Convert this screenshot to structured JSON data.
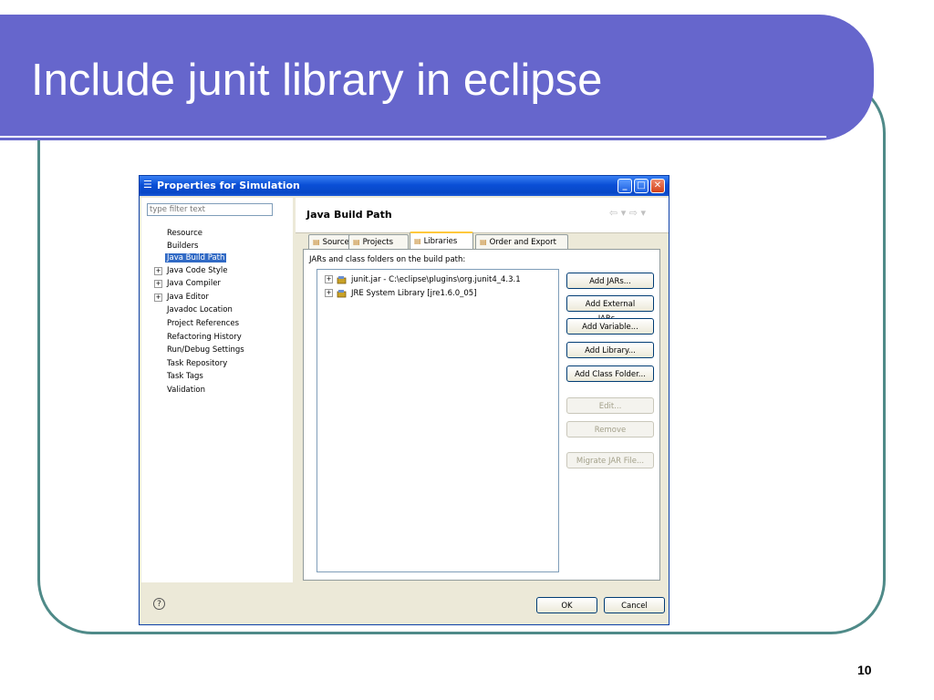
{
  "slide": {
    "title": "Include junit library in eclipse",
    "page_number": "10",
    "colors": {
      "banner": "#6666cc",
      "frame": "#4f8a88"
    }
  },
  "dialog": {
    "title": "Properties for Simulation",
    "filter_placeholder": "type filter text",
    "tree": [
      {
        "label": "Resource",
        "expandable": false,
        "selected": false
      },
      {
        "label": "Builders",
        "expandable": false,
        "selected": false
      },
      {
        "label": "Java Build Path",
        "expandable": false,
        "selected": true
      },
      {
        "label": "Java Code Style",
        "expandable": true,
        "selected": false
      },
      {
        "label": "Java Compiler",
        "expandable": true,
        "selected": false
      },
      {
        "label": "Java Editor",
        "expandable": true,
        "selected": false
      },
      {
        "label": "Javadoc Location",
        "expandable": false,
        "selected": false
      },
      {
        "label": "Project References",
        "expandable": false,
        "selected": false
      },
      {
        "label": "Refactoring History",
        "expandable": false,
        "selected": false
      },
      {
        "label": "Run/Debug Settings",
        "expandable": false,
        "selected": false
      },
      {
        "label": "Task Repository",
        "expandable": false,
        "selected": false
      },
      {
        "label": "Task Tags",
        "expandable": false,
        "selected": false
      },
      {
        "label": "Validation",
        "expandable": false,
        "selected": false
      }
    ],
    "page_title": "Java Build Path",
    "tabs": [
      {
        "label": "Source",
        "icon": "source-folder-icon",
        "active": false
      },
      {
        "label": "Projects",
        "icon": "projects-folder-icon",
        "active": false
      },
      {
        "label": "Libraries",
        "icon": "libraries-icon",
        "active": true
      },
      {
        "label": "Order and Export",
        "icon": "order-export-icon",
        "active": false
      }
    ],
    "panel_label": "JARs and class folders on the build path:",
    "libraries": [
      {
        "label": "junit.jar - C:\\eclipse\\plugins\\org.junit4_4.3.1",
        "icon": "jar-icon"
      },
      {
        "label": "JRE System Library [jre1.6.0_05]",
        "icon": "library-icon"
      }
    ],
    "buttons": [
      {
        "label": "Add JARs...",
        "enabled": true
      },
      {
        "label": "Add External JARs...",
        "enabled": true
      },
      {
        "label": "Add Variable...",
        "enabled": true
      },
      {
        "label": "Add Library...",
        "enabled": true
      },
      {
        "label": "Add Class Folder...",
        "enabled": true
      },
      {
        "label": "Edit...",
        "enabled": false
      },
      {
        "label": "Remove",
        "enabled": false
      },
      {
        "label": "Migrate JAR File...",
        "enabled": false
      }
    ],
    "ok_label": "OK",
    "cancel_label": "Cancel",
    "help_glyph": "?"
  }
}
